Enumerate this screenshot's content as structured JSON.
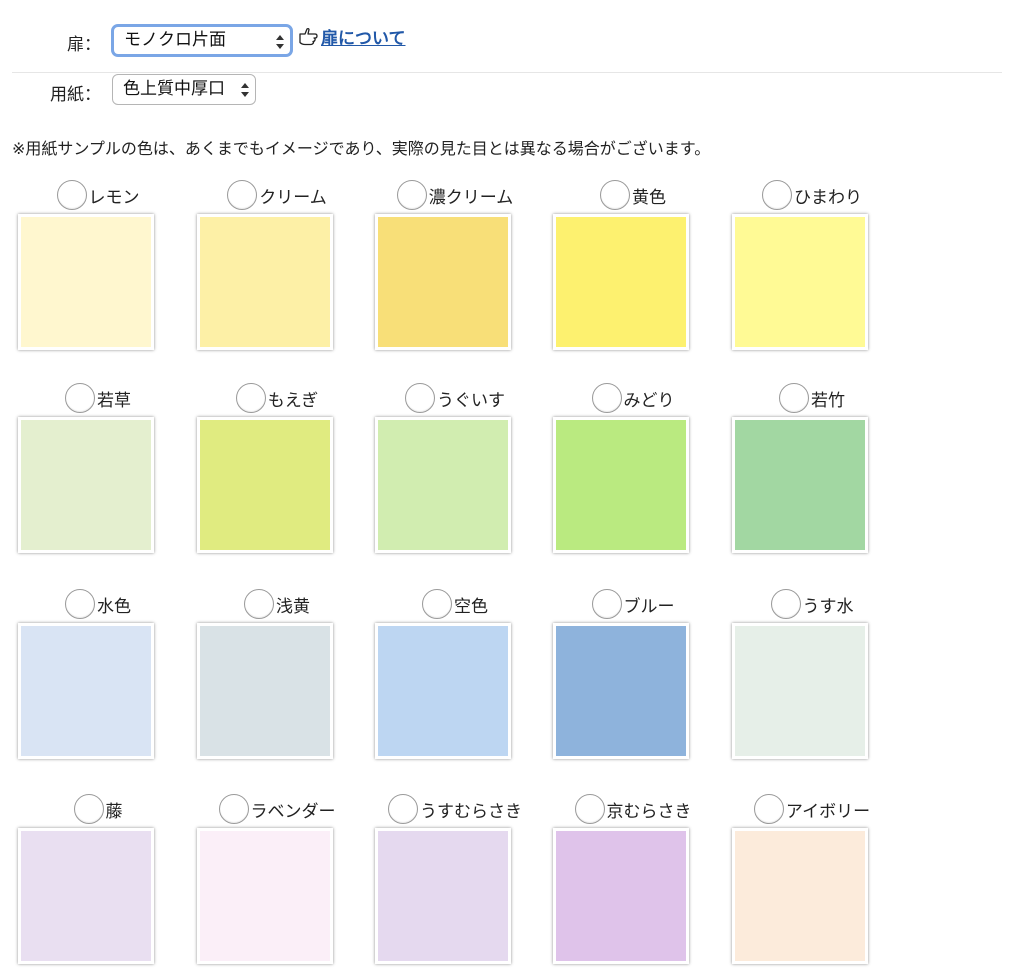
{
  "door": {
    "label": "扉：",
    "selected": "モノクロ片面",
    "link_text": "扉について"
  },
  "paper": {
    "label": "用紙：",
    "selected": "色上質中厚口"
  },
  "notice": "※用紙サンプルの色は、あくまでもイメージであり、実際の見た目とは異なる場合がございます。",
  "swatches": [
    {
      "name": "レモン",
      "color": "#fff7cf"
    },
    {
      "name": "クリーム",
      "color": "#fdf0a6"
    },
    {
      "name": "濃クリーム",
      "color": "#f8df78"
    },
    {
      "name": "黄色",
      "color": "#fdf16f"
    },
    {
      "name": "ひまわり",
      "color": "#fffa95"
    },
    {
      "name": "若草",
      "color": "#e4efcf"
    },
    {
      "name": "もえぎ",
      "color": "#e0eb80"
    },
    {
      "name": "うぐいす",
      "color": "#d1edb0"
    },
    {
      "name": "みどり",
      "color": "#baea80"
    },
    {
      "name": "若竹",
      "color": "#a2d7a2"
    },
    {
      "name": "水色",
      "color": "#d9e4f4"
    },
    {
      "name": "浅黄",
      "color": "#d9e2e6"
    },
    {
      "name": "空色",
      "color": "#bdd6f2"
    },
    {
      "name": "ブルー",
      "color": "#8eb3dc"
    },
    {
      "name": "うす水",
      "color": "#e6efe8"
    },
    {
      "name": "藤",
      "color": "#e9dff1"
    },
    {
      "name": "ラベンダー",
      "color": "#fbeff8"
    },
    {
      "name": "うすむらさき",
      "color": "#e5d9ef"
    },
    {
      "name": "京むらさき",
      "color": "#dfc3ea"
    },
    {
      "name": "アイボリー",
      "color": "#fcebdb"
    }
  ]
}
